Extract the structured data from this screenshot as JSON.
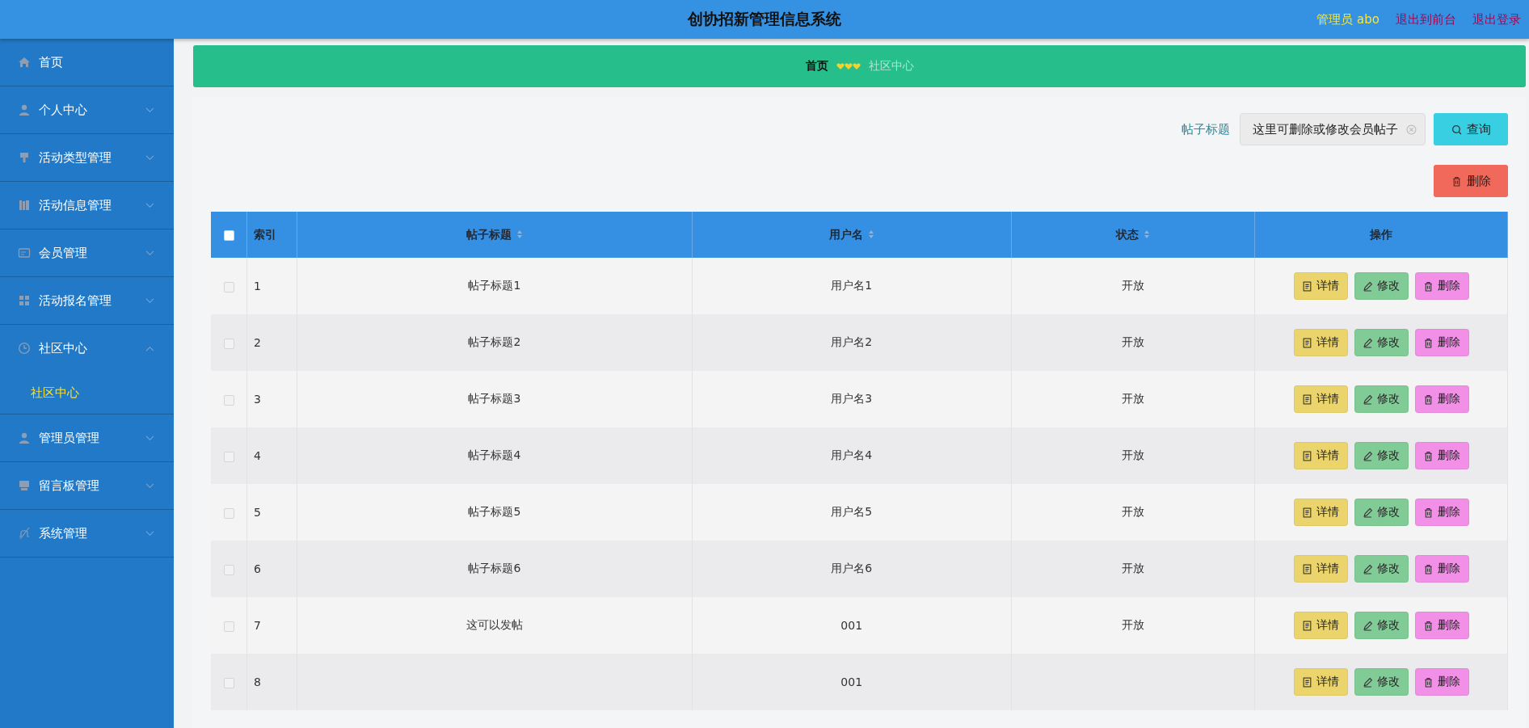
{
  "header": {
    "title": "创协招新管理信息系统",
    "user": "管理员 abo",
    "links": [
      "退出到前台",
      "退出登录"
    ]
  },
  "sidebar": {
    "items": [
      {
        "label": "首页",
        "kind": "link"
      },
      {
        "label": "个人中心",
        "kind": "menu",
        "expanded": false
      },
      {
        "label": "活动类型管理",
        "kind": "menu",
        "expanded": false
      },
      {
        "label": "活动信息管理",
        "kind": "menu",
        "expanded": false
      },
      {
        "label": "会员管理",
        "kind": "menu",
        "expanded": false
      },
      {
        "label": "活动报名管理",
        "kind": "menu",
        "expanded": false
      },
      {
        "label": "社区中心",
        "kind": "menu",
        "expanded": true,
        "children": [
          {
            "label": "社区中心",
            "selected": true
          }
        ]
      },
      {
        "label": "管理员管理",
        "kind": "menu",
        "expanded": false
      },
      {
        "label": "留言板管理",
        "kind": "menu",
        "expanded": false
      },
      {
        "label": "系统管理",
        "kind": "menu",
        "expanded": false
      }
    ]
  },
  "breadcrumb": [
    "首页",
    "社区中心"
  ],
  "search": {
    "label": "帖子标题",
    "value": "这里可删除或修改会员帖子",
    "button": "查询"
  },
  "delete_button": "删除",
  "table": {
    "select_all": {
      "checked": false
    },
    "columns": [
      {
        "label": "索引",
        "sortable": false
      },
      {
        "label": "帖子标题",
        "sortable": true
      },
      {
        "label": "用户名",
        "sortable": true
      },
      {
        "label": "状态",
        "sortable": true
      },
      {
        "label": "操作",
        "sortable": false
      }
    ],
    "rows": [
      {
        "checked": false,
        "index": "1",
        "title": "帖子标题1",
        "user": "用户名1",
        "status": "开放",
        "actions": [
          "详情",
          "修改",
          "删除"
        ]
      },
      {
        "checked": false,
        "index": "2",
        "title": "帖子标题2",
        "user": "用户名2",
        "status": "开放",
        "actions": [
          "详情",
          "修改",
          "删除"
        ]
      },
      {
        "checked": false,
        "index": "3",
        "title": "帖子标题3",
        "user": "用户名3",
        "status": "开放",
        "actions": [
          "详情",
          "修改",
          "删除"
        ]
      },
      {
        "checked": false,
        "index": "4",
        "title": "帖子标题4",
        "user": "用户名4",
        "status": "开放",
        "actions": [
          "详情",
          "修改",
          "删除"
        ]
      },
      {
        "checked": false,
        "index": "5",
        "title": "帖子标题5",
        "user": "用户名5",
        "status": "开放",
        "actions": [
          "详情",
          "修改",
          "删除"
        ]
      },
      {
        "checked": false,
        "index": "6",
        "title": "帖子标题6",
        "user": "用户名6",
        "status": "开放",
        "actions": [
          "详情",
          "修改",
          "删除"
        ]
      },
      {
        "checked": false,
        "index": "7",
        "title": "这可以发帖",
        "user": "001",
        "status": "开放",
        "actions": [
          "详情",
          "修改",
          "删除"
        ]
      },
      {
        "checked": false,
        "index": "8",
        "user": "001",
        "actions": [
          "详情",
          "修改",
          "删除"
        ]
      }
    ]
  }
}
